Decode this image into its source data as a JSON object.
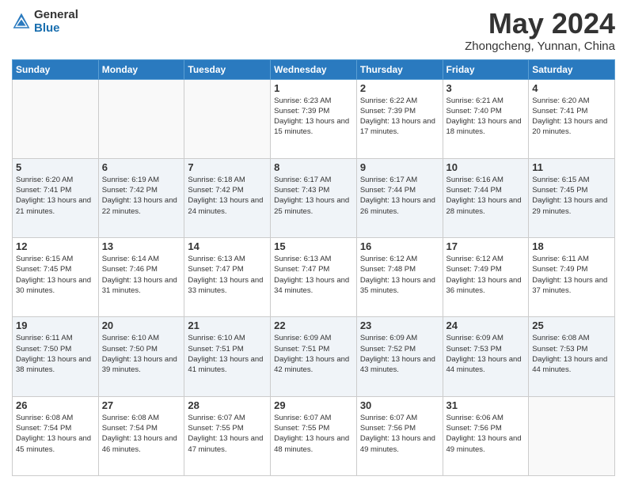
{
  "header": {
    "logo_general": "General",
    "logo_blue": "Blue",
    "month": "May 2024",
    "location": "Zhongcheng, Yunnan, China"
  },
  "days_of_week": [
    "Sunday",
    "Monday",
    "Tuesday",
    "Wednesday",
    "Thursday",
    "Friday",
    "Saturday"
  ],
  "weeks": [
    {
      "days": [
        {
          "num": "",
          "empty": true
        },
        {
          "num": "",
          "empty": true
        },
        {
          "num": "",
          "empty": true
        },
        {
          "num": "1",
          "sunrise": "6:23 AM",
          "sunset": "7:39 PM",
          "daylight": "13 hours and 15 minutes."
        },
        {
          "num": "2",
          "sunrise": "6:22 AM",
          "sunset": "7:39 PM",
          "daylight": "13 hours and 17 minutes."
        },
        {
          "num": "3",
          "sunrise": "6:21 AM",
          "sunset": "7:40 PM",
          "daylight": "13 hours and 18 minutes."
        },
        {
          "num": "4",
          "sunrise": "6:20 AM",
          "sunset": "7:41 PM",
          "daylight": "13 hours and 20 minutes."
        }
      ]
    },
    {
      "days": [
        {
          "num": "5",
          "sunrise": "6:20 AM",
          "sunset": "7:41 PM",
          "daylight": "13 hours and 21 minutes."
        },
        {
          "num": "6",
          "sunrise": "6:19 AM",
          "sunset": "7:42 PM",
          "daylight": "13 hours and 22 minutes."
        },
        {
          "num": "7",
          "sunrise": "6:18 AM",
          "sunset": "7:42 PM",
          "daylight": "13 hours and 24 minutes."
        },
        {
          "num": "8",
          "sunrise": "6:17 AM",
          "sunset": "7:43 PM",
          "daylight": "13 hours and 25 minutes."
        },
        {
          "num": "9",
          "sunrise": "6:17 AM",
          "sunset": "7:44 PM",
          "daylight": "13 hours and 26 minutes."
        },
        {
          "num": "10",
          "sunrise": "6:16 AM",
          "sunset": "7:44 PM",
          "daylight": "13 hours and 28 minutes."
        },
        {
          "num": "11",
          "sunrise": "6:15 AM",
          "sunset": "7:45 PM",
          "daylight": "13 hours and 29 minutes."
        }
      ]
    },
    {
      "days": [
        {
          "num": "12",
          "sunrise": "6:15 AM",
          "sunset": "7:45 PM",
          "daylight": "13 hours and 30 minutes."
        },
        {
          "num": "13",
          "sunrise": "6:14 AM",
          "sunset": "7:46 PM",
          "daylight": "13 hours and 31 minutes."
        },
        {
          "num": "14",
          "sunrise": "6:13 AM",
          "sunset": "7:47 PM",
          "daylight": "13 hours and 33 minutes."
        },
        {
          "num": "15",
          "sunrise": "6:13 AM",
          "sunset": "7:47 PM",
          "daylight": "13 hours and 34 minutes."
        },
        {
          "num": "16",
          "sunrise": "6:12 AM",
          "sunset": "7:48 PM",
          "daylight": "13 hours and 35 minutes."
        },
        {
          "num": "17",
          "sunrise": "6:12 AM",
          "sunset": "7:49 PM",
          "daylight": "13 hours and 36 minutes."
        },
        {
          "num": "18",
          "sunrise": "6:11 AM",
          "sunset": "7:49 PM",
          "daylight": "13 hours and 37 minutes."
        }
      ]
    },
    {
      "days": [
        {
          "num": "19",
          "sunrise": "6:11 AM",
          "sunset": "7:50 PM",
          "daylight": "13 hours and 38 minutes."
        },
        {
          "num": "20",
          "sunrise": "6:10 AM",
          "sunset": "7:50 PM",
          "daylight": "13 hours and 39 minutes."
        },
        {
          "num": "21",
          "sunrise": "6:10 AM",
          "sunset": "7:51 PM",
          "daylight": "13 hours and 41 minutes."
        },
        {
          "num": "22",
          "sunrise": "6:09 AM",
          "sunset": "7:51 PM",
          "daylight": "13 hours and 42 minutes."
        },
        {
          "num": "23",
          "sunrise": "6:09 AM",
          "sunset": "7:52 PM",
          "daylight": "13 hours and 43 minutes."
        },
        {
          "num": "24",
          "sunrise": "6:09 AM",
          "sunset": "7:53 PM",
          "daylight": "13 hours and 44 minutes."
        },
        {
          "num": "25",
          "sunrise": "6:08 AM",
          "sunset": "7:53 PM",
          "daylight": "13 hours and 44 minutes."
        }
      ]
    },
    {
      "days": [
        {
          "num": "26",
          "sunrise": "6:08 AM",
          "sunset": "7:54 PM",
          "daylight": "13 hours and 45 minutes."
        },
        {
          "num": "27",
          "sunrise": "6:08 AM",
          "sunset": "7:54 PM",
          "daylight": "13 hours and 46 minutes."
        },
        {
          "num": "28",
          "sunrise": "6:07 AM",
          "sunset": "7:55 PM",
          "daylight": "13 hours and 47 minutes."
        },
        {
          "num": "29",
          "sunrise": "6:07 AM",
          "sunset": "7:55 PM",
          "daylight": "13 hours and 48 minutes."
        },
        {
          "num": "30",
          "sunrise": "6:07 AM",
          "sunset": "7:56 PM",
          "daylight": "13 hours and 49 minutes."
        },
        {
          "num": "31",
          "sunrise": "6:06 AM",
          "sunset": "7:56 PM",
          "daylight": "13 hours and 49 minutes."
        },
        {
          "num": "",
          "empty": true
        }
      ]
    }
  ],
  "labels": {
    "sunrise": "Sunrise:",
    "sunset": "Sunset:",
    "daylight": "Daylight:"
  }
}
